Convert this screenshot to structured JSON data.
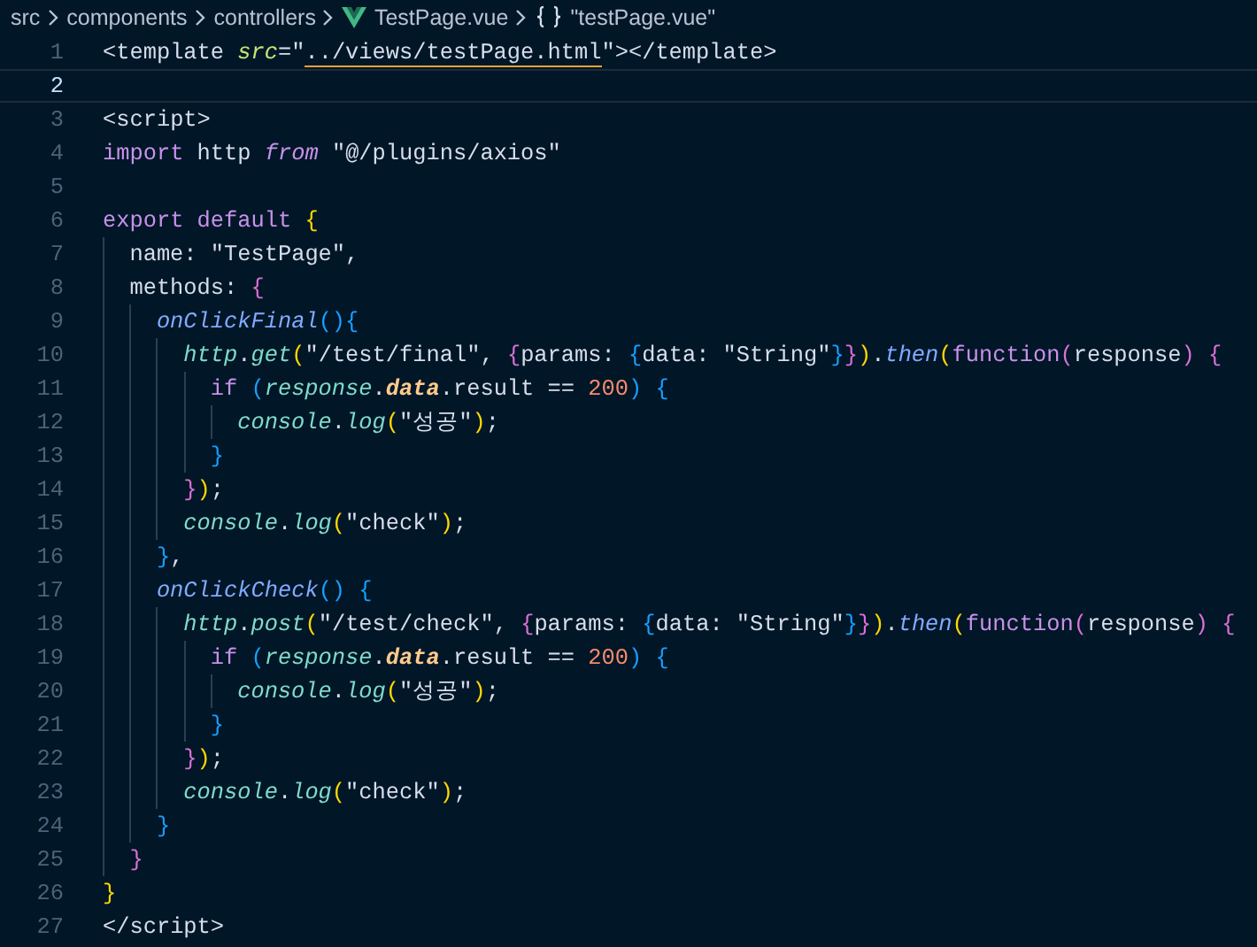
{
  "breadcrumb": [
    {
      "text": "src",
      "kind": "folder"
    },
    {
      "text": "components",
      "kind": "folder"
    },
    {
      "text": "controllers",
      "kind": "folder"
    },
    {
      "text": "TestPage.vue",
      "kind": "vue-file"
    },
    {
      "text": "\"testPage.vue\"",
      "kind": "symbol"
    }
  ],
  "lines": [
    {
      "number": "1",
      "current": false,
      "tokens": [
        {
          "text": "<template ",
          "kind": "plain"
        },
        {
          "text": "src",
          "kind": "attr"
        },
        {
          "text": "=\"",
          "kind": "plain"
        },
        {
          "text": "../views/testPage.html",
          "kind": "link"
        },
        {
          "text": "\"></template>",
          "kind": "plain"
        }
      ]
    },
    {
      "number": "2",
      "current": true
    },
    {
      "number": "3",
      "current": false,
      "tokens": [
        {
          "text": "<script>",
          "kind": "plain"
        }
      ]
    },
    {
      "number": "4",
      "current": false,
      "tokens": [
        {
          "text": "import",
          "kind": "keyword"
        },
        {
          "text": " http ",
          "kind": "plain"
        },
        {
          "text": "from",
          "kind": "keyword-italic"
        },
        {
          "text": " \"@/plugins/axios\"",
          "kind": "plain"
        }
      ]
    },
    {
      "number": "5",
      "current": false
    },
    {
      "number": "6",
      "current": false,
      "tokens": [
        {
          "text": "export",
          "kind": "keyword"
        },
        {
          "text": " default",
          "kind": "keyword"
        },
        {
          "text": " {",
          "kind": "b1"
        }
      ]
    },
    {
      "number": "7",
      "current": false,
      "tokens": [
        {
          "text": "  name: \"TestPage\",",
          "kind": "plain"
        }
      ]
    },
    {
      "number": "8",
      "current": false,
      "tokens": [
        {
          "text": "  methods: ",
          "kind": "plain"
        },
        {
          "text": "{",
          "kind": "b2"
        }
      ]
    },
    {
      "number": "9",
      "current": false,
      "tokens": [
        {
          "text": "    onClickFinal",
          "kind": "func"
        },
        {
          "text": "(){",
          "kind": "b3"
        }
      ]
    },
    {
      "number": "10",
      "current": false,
      "tokens": [
        {
          "text": "      http",
          "kind": "member"
        },
        {
          "text": ".",
          "kind": "plain"
        },
        {
          "text": "get",
          "kind": "member"
        },
        {
          "text": "(",
          "kind": "b1"
        },
        {
          "text": "\"/test/final\", ",
          "kind": "plain"
        },
        {
          "text": "{",
          "kind": "b2"
        },
        {
          "text": "params: ",
          "kind": "plain"
        },
        {
          "text": "{",
          "kind": "b3"
        },
        {
          "text": "data: \"String\"",
          "kind": "plain"
        },
        {
          "text": "}",
          "kind": "b3"
        },
        {
          "text": "}",
          "kind": "b2"
        },
        {
          "text": ")",
          "kind": "b1"
        },
        {
          "text": ".",
          "kind": "plain"
        },
        {
          "text": "then",
          "kind": "func"
        },
        {
          "text": "(",
          "kind": "b1"
        },
        {
          "text": "function",
          "kind": "keyword"
        },
        {
          "text": "(",
          "kind": "b2"
        },
        {
          "text": "response",
          "kind": "plain"
        },
        {
          "text": ")",
          "kind": "b2"
        },
        {
          "text": " {",
          "kind": "b2"
        }
      ]
    },
    {
      "number": "11",
      "current": false,
      "tokens": [
        {
          "text": "        if",
          "kind": "keyword"
        },
        {
          "text": " (",
          "kind": "b3"
        },
        {
          "text": "response",
          "kind": "member"
        },
        {
          "text": ".",
          "kind": "plain"
        },
        {
          "text": "data",
          "kind": "property"
        },
        {
          "text": ".result == ",
          "kind": "plain"
        },
        {
          "text": "200",
          "kind": "number"
        },
        {
          "text": ")",
          "kind": "b3"
        },
        {
          "text": " {",
          "kind": "b3"
        }
      ]
    },
    {
      "number": "12",
      "current": false,
      "tokens": [
        {
          "text": "          console",
          "kind": "member"
        },
        {
          "text": ".",
          "kind": "plain"
        },
        {
          "text": "log",
          "kind": "member"
        },
        {
          "text": "(",
          "kind": "b1"
        },
        {
          "text": "\"성공\"",
          "kind": "plain"
        },
        {
          "text": ")",
          "kind": "b1"
        },
        {
          "text": ";",
          "kind": "plain"
        }
      ]
    },
    {
      "number": "13",
      "current": false,
      "tokens": [
        {
          "text": "        }",
          "kind": "b3"
        }
      ]
    },
    {
      "number": "14",
      "current": false,
      "tokens": [
        {
          "text": "      }",
          "kind": "b2"
        },
        {
          "text": ")",
          "kind": "b1"
        },
        {
          "text": ";",
          "kind": "plain"
        }
      ]
    },
    {
      "number": "15",
      "current": false,
      "tokens": [
        {
          "text": "      console",
          "kind": "member"
        },
        {
          "text": ".",
          "kind": "plain"
        },
        {
          "text": "log",
          "kind": "member"
        },
        {
          "text": "(",
          "kind": "b1"
        },
        {
          "text": "\"check\"",
          "kind": "plain"
        },
        {
          "text": ")",
          "kind": "b1"
        },
        {
          "text": ";",
          "kind": "plain"
        }
      ]
    },
    {
      "number": "16",
      "current": false,
      "tokens": [
        {
          "text": "    }",
          "kind": "b3"
        },
        {
          "text": ",",
          "kind": "plain"
        }
      ]
    },
    {
      "number": "17",
      "current": false,
      "tokens": [
        {
          "text": "    onClickCheck",
          "kind": "func"
        },
        {
          "text": "()",
          "kind": "b3"
        },
        {
          "text": " {",
          "kind": "b3"
        }
      ]
    },
    {
      "number": "18",
      "current": false,
      "tokens": [
        {
          "text": "      http",
          "kind": "member"
        },
        {
          "text": ".",
          "kind": "plain"
        },
        {
          "text": "post",
          "kind": "member"
        },
        {
          "text": "(",
          "kind": "b1"
        },
        {
          "text": "\"/test/check\", ",
          "kind": "plain"
        },
        {
          "text": "{",
          "kind": "b2"
        },
        {
          "text": "params: ",
          "kind": "plain"
        },
        {
          "text": "{",
          "kind": "b3"
        },
        {
          "text": "data: \"String\"",
          "kind": "plain"
        },
        {
          "text": "}",
          "kind": "b3"
        },
        {
          "text": "}",
          "kind": "b2"
        },
        {
          "text": ")",
          "kind": "b1"
        },
        {
          "text": ".",
          "kind": "plain"
        },
        {
          "text": "then",
          "kind": "func"
        },
        {
          "text": "(",
          "kind": "b1"
        },
        {
          "text": "function",
          "kind": "keyword"
        },
        {
          "text": "(",
          "kind": "b2"
        },
        {
          "text": "response",
          "kind": "plain"
        },
        {
          "text": ")",
          "kind": "b2"
        },
        {
          "text": " {",
          "kind": "b2"
        }
      ]
    },
    {
      "number": "19",
      "current": false,
      "tokens": [
        {
          "text": "        if",
          "kind": "keyword"
        },
        {
          "text": " (",
          "kind": "b3"
        },
        {
          "text": "response",
          "kind": "member"
        },
        {
          "text": ".",
          "kind": "plain"
        },
        {
          "text": "data",
          "kind": "property"
        },
        {
          "text": ".result == ",
          "kind": "plain"
        },
        {
          "text": "200",
          "kind": "number"
        },
        {
          "text": ")",
          "kind": "b3"
        },
        {
          "text": " {",
          "kind": "b3"
        }
      ]
    },
    {
      "number": "20",
      "current": false,
      "tokens": [
        {
          "text": "          console",
          "kind": "member"
        },
        {
          "text": ".",
          "kind": "plain"
        },
        {
          "text": "log",
          "kind": "member"
        },
        {
          "text": "(",
          "kind": "b1"
        },
        {
          "text": "\"성공\"",
          "kind": "plain"
        },
        {
          "text": ")",
          "kind": "b1"
        },
        {
          "text": ";",
          "kind": "plain"
        }
      ]
    },
    {
      "number": "21",
      "current": false,
      "tokens": [
        {
          "text": "        }",
          "kind": "b3"
        }
      ]
    },
    {
      "number": "22",
      "current": false,
      "tokens": [
        {
          "text": "      }",
          "kind": "b2"
        },
        {
          "text": ")",
          "kind": "b1"
        },
        {
          "text": ";",
          "kind": "plain"
        }
      ]
    },
    {
      "number": "23",
      "current": false,
      "tokens": [
        {
          "text": "      console",
          "kind": "member"
        },
        {
          "text": ".",
          "kind": "plain"
        },
        {
          "text": "log",
          "kind": "member"
        },
        {
          "text": "(",
          "kind": "b1"
        },
        {
          "text": "\"check\"",
          "kind": "plain"
        },
        {
          "text": ")",
          "kind": "b1"
        },
        {
          "text": ";",
          "kind": "plain"
        }
      ]
    },
    {
      "number": "24",
      "current": false,
      "tokens": [
        {
          "text": "    }",
          "kind": "b3"
        }
      ]
    },
    {
      "number": "25",
      "current": false,
      "tokens": [
        {
          "text": "  }",
          "kind": "b2"
        }
      ]
    },
    {
      "number": "26",
      "current": false,
      "tokens": [
        {
          "text": "}",
          "kind": "b1"
        }
      ]
    },
    {
      "number": "27",
      "current": false,
      "tokens": [
        {
          "text": "</script>",
          "kind": "plain"
        }
      ]
    }
  ]
}
